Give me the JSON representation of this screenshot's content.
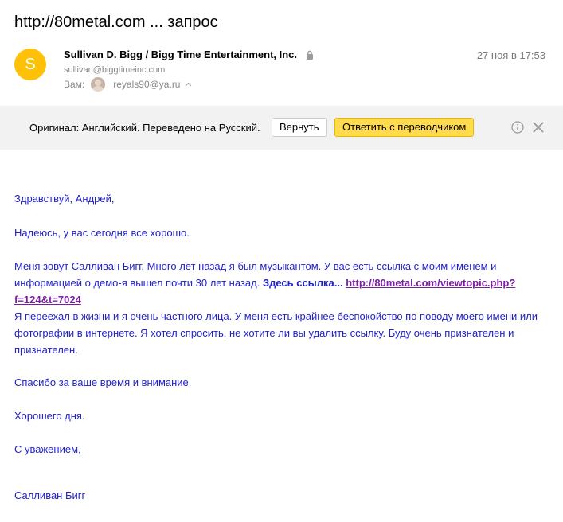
{
  "subject": "http://80metal.com ... запрос",
  "sender": {
    "avatar_letter": "S",
    "avatar_color": "#ffc107",
    "name": "Sullivan D. Bigg / Bigg Time Entertainment, Inc.",
    "email": "sullivan@biggtimeinc.com",
    "date": "27 ноя в 17:53"
  },
  "recipient": {
    "label": "Вам:",
    "email": "reyals90@ya.ru"
  },
  "translate_bar": {
    "text": "Оригинал: Английский. Переведено на Русский.",
    "revert_label": "Вернуть",
    "reply_translate_label": "Ответить с переводчиком"
  },
  "body": {
    "greeting": "Здравствуй, Андрей,",
    "p1": "Надеюсь, у вас сегодня все хорошо.",
    "p2_text": "Меня зовут Салливан Бигг. Много лет назад я был музыкантом. У вас есть ссылка с моим именем и информацией о демо-я вышел почти 30 лет назад. ",
    "p2_bold": "Здесь ссылка... ",
    "p2_link": "http://80metal.com/viewtopic.php?f=124&t=7024",
    "p3": "Я переехал в жизни и я очень частного лица. У меня есть крайнее беспокойство по поводу моего имени или фотографии в интернете. Я хотел спросить, не хотите ли вы удалить ссылку. Буду очень признателен и признателен.",
    "p4": "Спасибо за ваше время и внимание.",
    "p5": "Хорошего дня.",
    "p6": "С уважением,",
    "signature": "Салливан Бигг"
  },
  "colors": {
    "body_text": "#2222cc",
    "link": "#7a1fa2",
    "bar_bg": "#f2f2f2",
    "accent_button": "#ffdb4d"
  }
}
